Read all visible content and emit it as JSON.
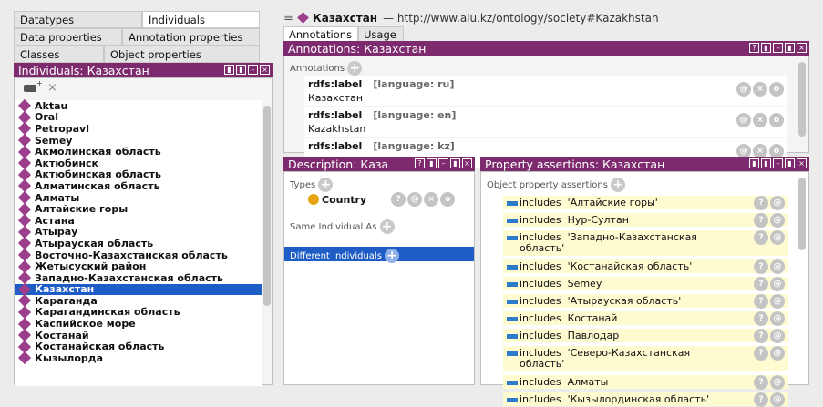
{
  "left_tabs": {
    "datatypes": "Datatypes",
    "individuals": "Individuals",
    "data_properties": "Data properties",
    "annotation_properties": "Annotation properties",
    "classes": "Classes",
    "object_properties": "Object properties"
  },
  "individuals_panel": {
    "title": "Individuals: Казахстан",
    "items": [
      "Aktau",
      "Oral",
      "Petropavl",
      "Semey",
      "Акмолинская область",
      "Актюбинск",
      "Актюбинская область",
      "Алматинская область",
      "Алматы",
      "Алтайские горы",
      "Астана",
      "Атырау",
      "Атырауская область",
      "Восточно-Казахстанская область",
      "Жетысуский район",
      "Западно-Казахстанская область",
      "Казахстан",
      "Караганда",
      "Карагандинская область",
      "Каспийское море",
      "Костанай",
      "Костанайская область",
      "Кызылорда"
    ],
    "selected": "Казахстан"
  },
  "header": {
    "entity": "Казахстан",
    "iri": "— http://www.aiu.kz/ontology/society#Kazakhstan"
  },
  "tabs": {
    "annotations": "Annotations",
    "usage": "Usage"
  },
  "annotations_panel": {
    "title": "Annotations: Казахстан",
    "section": "Annotations",
    "items": [
      {
        "prop": "rdfs:label",
        "lang": "[language: ru]",
        "value": "Казахстан"
      },
      {
        "prop": "rdfs:label",
        "lang": "[language: en]",
        "value": "Kazakhstan"
      },
      {
        "prop": "rdfs:label",
        "lang": "[language: kz]",
        "value": ""
      }
    ]
  },
  "description_panel": {
    "title": "Description: Каза",
    "types_label": "Types",
    "type_value": "Country",
    "same_label": "Same Individual As",
    "different_label": "Different Individuals"
  },
  "property_panel": {
    "title": "Property assertions: Казахстан",
    "section": "Object property assertions",
    "items": [
      {
        "prop": "includes",
        "value": "'Алтайские горы'",
        "value2": ""
      },
      {
        "prop": "includes",
        "value": "Нур-Султан",
        "value2": ""
      },
      {
        "prop": "includes",
        "value": "'Западно-Казахстанская",
        "value2": "область'"
      },
      {
        "prop": "includes",
        "value": "'Костанайская область'",
        "value2": ""
      },
      {
        "prop": "includes",
        "value": "Semey",
        "value2": ""
      },
      {
        "prop": "includes",
        "value": "'Атырауская область'",
        "value2": ""
      },
      {
        "prop": "includes",
        "value": "Костанай",
        "value2": ""
      },
      {
        "prop": "includes",
        "value": "Павлодар",
        "value2": ""
      },
      {
        "prop": "includes",
        "value": "'Северо-Казахстанская",
        "value2": "область'"
      },
      {
        "prop": "includes",
        "value": "Алматы",
        "value2": ""
      },
      {
        "prop": "includes",
        "value": "'Кызылординская область'",
        "value2": ""
      }
    ]
  },
  "colors": {
    "title_bar": "#7d2b6e",
    "selection": "#1f5dc6",
    "assertion_bg": "#fffbd1",
    "individual_icon": "#9b3f8c",
    "class_icon": "#e6a410"
  }
}
